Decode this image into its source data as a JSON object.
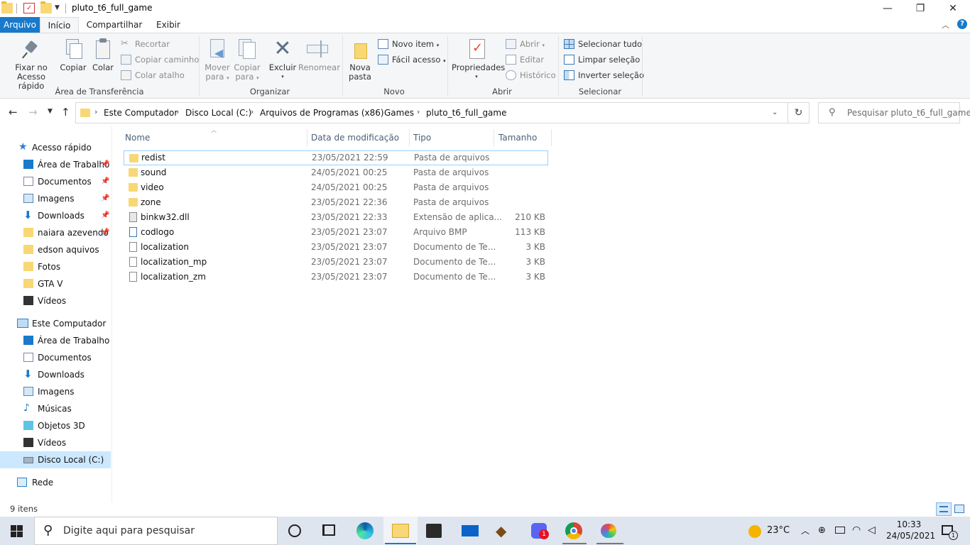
{
  "window": {
    "title": "pluto_t6_full_game",
    "minimize_glyph": "—",
    "maximize_glyph": "❐",
    "close_glyph": "✕"
  },
  "tabs": {
    "arquivo": "Arquivo",
    "inicio": "Início",
    "compartilhar": "Compartilhar",
    "exibir": "Exibir"
  },
  "ribbon": {
    "clipboard": {
      "pin_label_1": "Fixar no",
      "pin_label_2": "Acesso rápido",
      "copy": "Copiar",
      "paste": "Colar",
      "cut": "Recortar",
      "copy_path": "Copiar caminho",
      "paste_shortcut": "Colar atalho",
      "group": "Área de Transferência"
    },
    "organize": {
      "move_1": "Mover",
      "move_2": "para",
      "copyto_1": "Copiar",
      "copyto_2": "para",
      "delete": "Excluir",
      "rename": "Renomear",
      "group": "Organizar"
    },
    "new": {
      "new_folder_1": "Nova",
      "new_folder_2": "pasta",
      "new_item": "Novo item",
      "easy_access": "Fácil acesso",
      "group": "Novo"
    },
    "open": {
      "properties": "Propriedades",
      "open": "Abrir",
      "edit": "Editar",
      "history": "Histórico",
      "group": "Abrir"
    },
    "select": {
      "select_all": "Selecionar tudo",
      "select_none": "Limpar seleção",
      "invert": "Inverter seleção",
      "group": "Selecionar"
    }
  },
  "address": {
    "crumbs": [
      "Este Computador",
      "Disco Local (C:)",
      "Arquivos de Programas (x86)",
      "Games",
      "pluto_t6_full_game"
    ],
    "search_placeholder": "Pesquisar pluto_t6_full_game"
  },
  "sidebar": {
    "quick_access": "Acesso rápido",
    "quick_items": [
      {
        "label": "Área de Trabalho",
        "pinned": true
      },
      {
        "label": "Documentos",
        "pinned": true
      },
      {
        "label": "Imagens",
        "pinned": true
      },
      {
        "label": "Downloads",
        "pinned": true
      },
      {
        "label": "naiara azevendo",
        "pinned": true
      },
      {
        "label": "edson aquivos",
        "pinned": false
      },
      {
        "label": "Fotos",
        "pinned": false
      },
      {
        "label": "GTA V",
        "pinned": false
      },
      {
        "label": "Vídeos",
        "pinned": false
      }
    ],
    "this_pc": "Este Computador",
    "pc_items": [
      "Área de Trabalho",
      "Documentos",
      "Downloads",
      "Imagens",
      "Músicas",
      "Objetos 3D",
      "Vídeos",
      "Disco Local (C:)"
    ],
    "network": "Rede"
  },
  "columns": {
    "name": "Nome",
    "date": "Data de modificação",
    "type": "Tipo",
    "size": "Tamanho"
  },
  "files": [
    {
      "name": "redist",
      "date": "23/05/2021 22:59",
      "type": "Pasta de arquivos",
      "size": "",
      "icon": "folder"
    },
    {
      "name": "sound",
      "date": "24/05/2021 00:25",
      "type": "Pasta de arquivos",
      "size": "",
      "icon": "folder"
    },
    {
      "name": "video",
      "date": "24/05/2021 00:25",
      "type": "Pasta de arquivos",
      "size": "",
      "icon": "folder"
    },
    {
      "name": "zone",
      "date": "23/05/2021 22:36",
      "type": "Pasta de arquivos",
      "size": "",
      "icon": "folder"
    },
    {
      "name": "binkw32.dll",
      "date": "23/05/2021 22:33",
      "type": "Extensão de aplica...",
      "size": "210 KB",
      "icon": "dll"
    },
    {
      "name": "codlogo",
      "date": "23/05/2021 23:07",
      "type": "Arquivo BMP",
      "size": "113 KB",
      "icon": "bmp"
    },
    {
      "name": "localization",
      "date": "23/05/2021 23:07",
      "type": "Documento de Te...",
      "size": "3 KB",
      "icon": "doc"
    },
    {
      "name": "localization_mp",
      "date": "23/05/2021 23:07",
      "type": "Documento de Te...",
      "size": "3 KB",
      "icon": "doc"
    },
    {
      "name": "localization_zm",
      "date": "23/05/2021 23:07",
      "type": "Documento de Te...",
      "size": "3 KB",
      "icon": "doc"
    }
  ],
  "status": {
    "count": "9 itens"
  },
  "taskbar": {
    "search_placeholder": "Digite aqui para pesquisar",
    "weather": "23°C",
    "time": "10:33",
    "date": "24/05/2021",
    "notification_count": "1",
    "discord_badge": "1"
  },
  "colors": {
    "accent": "#1979ca",
    "selection": "#cce8ff",
    "folder": "#f8d775"
  }
}
